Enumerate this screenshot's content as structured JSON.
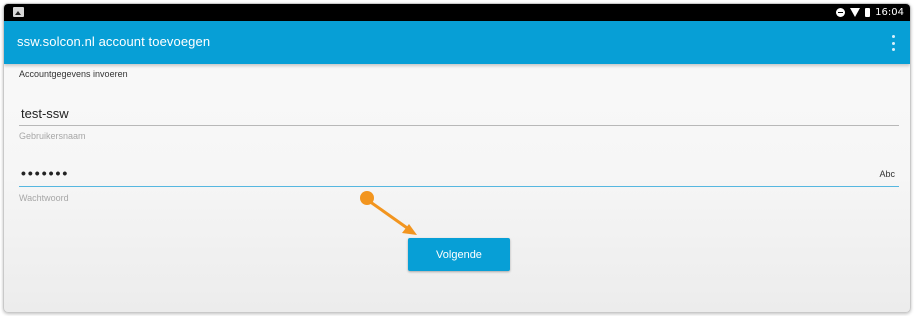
{
  "status_bar": {
    "time": "16:04",
    "icons": [
      "image-icon",
      "do-not-disturb-icon",
      "wifi-icon",
      "battery-icon"
    ]
  },
  "app_bar": {
    "title": "ssw.solcon.nl account toevoegen",
    "menu_icon": "overflow-menu-icon",
    "color": "#079fd6"
  },
  "form": {
    "section_label": "Accountgegevens invoeren",
    "username": {
      "value": "test-ssw",
      "caption": "Gebruikersnaam"
    },
    "password": {
      "value": "•••••••",
      "caption": "Wachtwoord",
      "toggle_label": "Abc"
    },
    "next_button": "Volgende"
  },
  "annotation": {
    "color": "#f2951f",
    "icon": "pointer-arrow-icon"
  }
}
